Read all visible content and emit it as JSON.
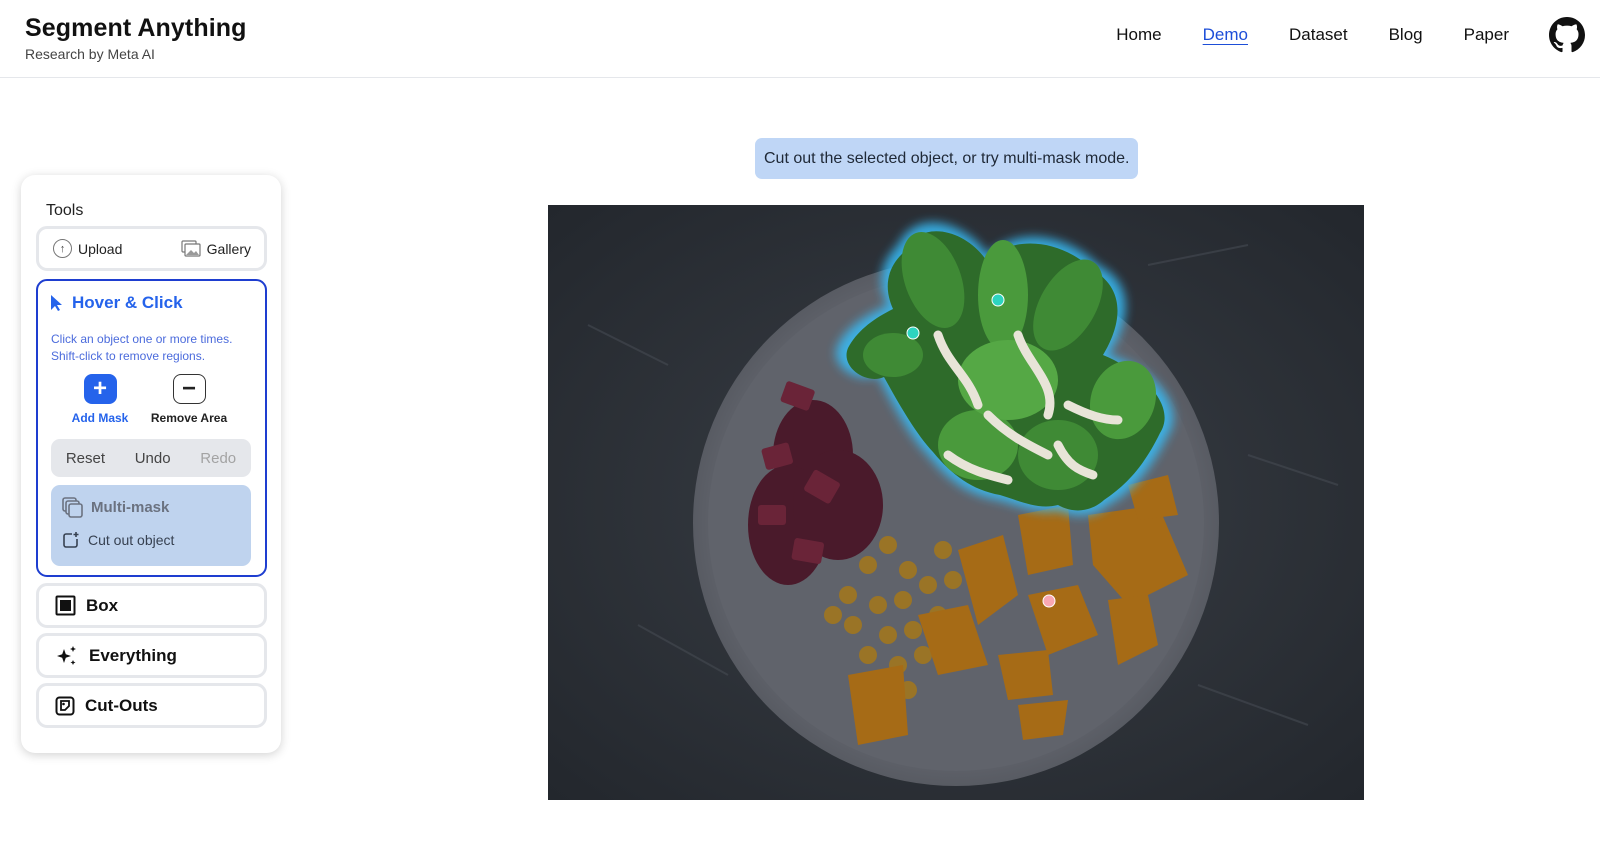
{
  "header": {
    "title": "Segment Anything",
    "subtitle": "Research by Meta AI",
    "nav": [
      {
        "label": "Home"
      },
      {
        "label": "Demo",
        "active": true
      },
      {
        "label": "Dataset"
      },
      {
        "label": "Blog"
      },
      {
        "label": "Paper"
      }
    ],
    "github_icon": "github-icon"
  },
  "hint": "Cut out the selected object, or try multi-mask mode.",
  "sidebar": {
    "tools_label": "Tools",
    "upload_label": "Upload",
    "gallery_label": "Gallery",
    "hover_click": {
      "title": "Hover & Click",
      "desc_line1": "Click an object one or more times.",
      "desc_line2": "Shift-click to remove regions.",
      "add_mask": "Add Mask",
      "remove_area": "Remove Area",
      "reset": "Reset",
      "undo": "Undo",
      "redo": "Redo",
      "multi_mask": "Multi-mask",
      "cut_out": "Cut out object"
    },
    "box": "Box",
    "everything": "Everything",
    "cut_outs": "Cut-Outs"
  },
  "colors": {
    "accent": "#2563eb",
    "hint_bg": "#bfd6f6",
    "mask_glow": "#38bdf8",
    "positive_point": "#2dd4bf",
    "negative_point": "#f9a8b4"
  }
}
